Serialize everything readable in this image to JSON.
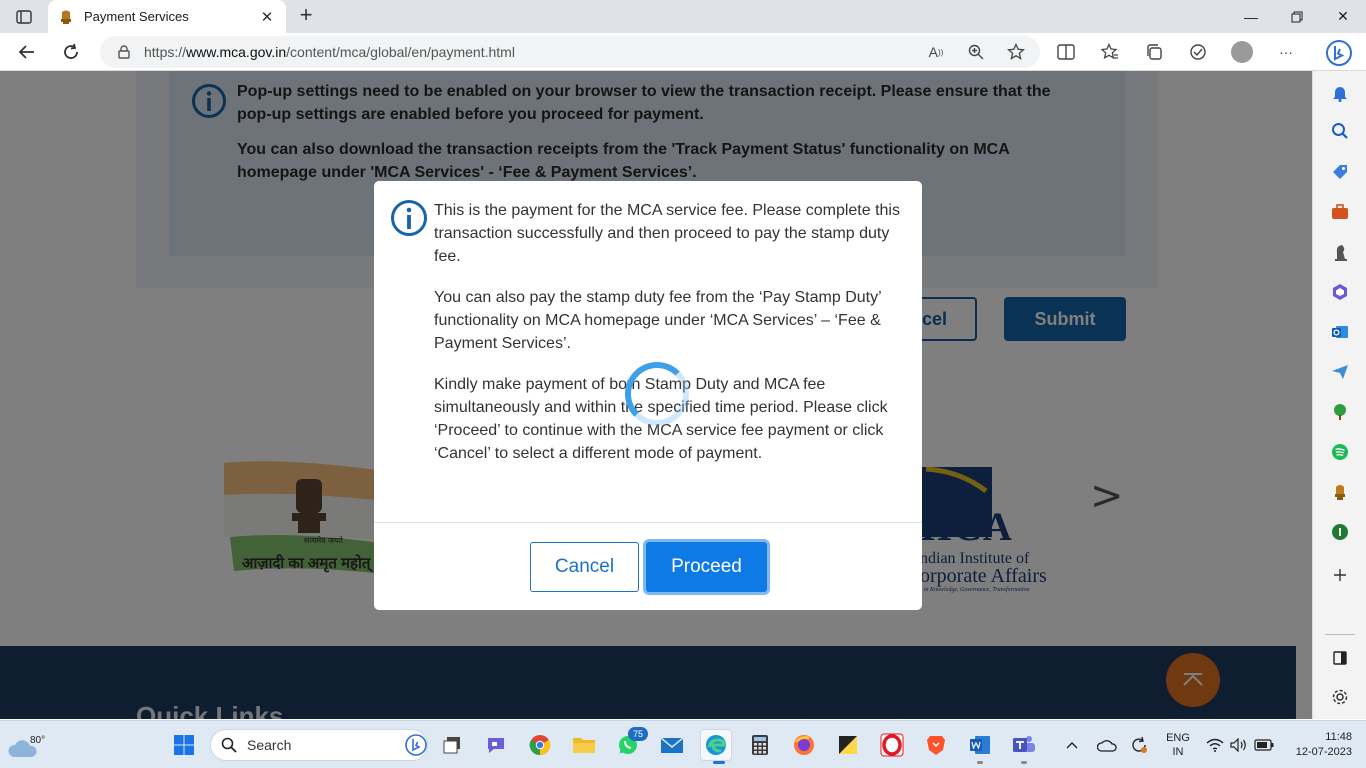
{
  "browser": {
    "tab_title": "Payment Services",
    "url_prefix": "https://",
    "url_domain": "www.mca.gov.in",
    "url_path": "/content/mca/global/en/payment.html"
  },
  "page": {
    "notice_line1": "Pop-up settings need to be enabled on your browser to view the transaction receipt. Please ensure that the pop-up settings are enabled before you proceed for payment.",
    "notice_line2": "You can also download the transaction receipts from the 'Track Payment Status' functionality on MCA homepage under 'MCA Services' - ‘Fee & Payment Services’.",
    "cancel_label_partial": "cel",
    "submit_label": "Submit",
    "azadi_text": "आज़ादी का अमृत महोत्",
    "azadi_subtext": "सत्यमेव जयते",
    "iica_logo_text": "IICA",
    "iica_name_line1": "ndian Institute of",
    "iica_name_line2": "orporate Affairs",
    "iica_tagline": "s in Knowledge, Governance, Transformation",
    "carousel_next": ">",
    "quick_links": "Quick Links"
  },
  "modal": {
    "para1": "This is the payment for the MCA service fee. Please complete this transaction successfully and then proceed to pay the stamp duty fee.",
    "para2": "You can also pay the stamp duty fee from the ‘Pay Stamp Duty’ functionality on MCA homepage under ‘MCA Services’ – ‘Fee & Payment Services’.",
    "para3": "Kindly make payment of both Stamp Duty and MCA fee simultaneously and within the specified time period. Please click ‘Proceed’ to continue with the MCA service fee payment or click ‘Cancel’ to select a different mode of payment.",
    "cancel_label": "Cancel",
    "proceed_label": "Proceed"
  },
  "taskbar": {
    "weather_temp": "80°",
    "search_placeholder": "Search",
    "whatsapp_badge": "75",
    "lang_line1": "ENG",
    "lang_line2": "IN",
    "time": "11:48",
    "date": "12-07-2023"
  },
  "colors": {
    "accent": "#0d7ae6",
    "mca_blue": "#1565a8",
    "footer": "#1f3a63",
    "scroll_top": "#e3731e"
  }
}
